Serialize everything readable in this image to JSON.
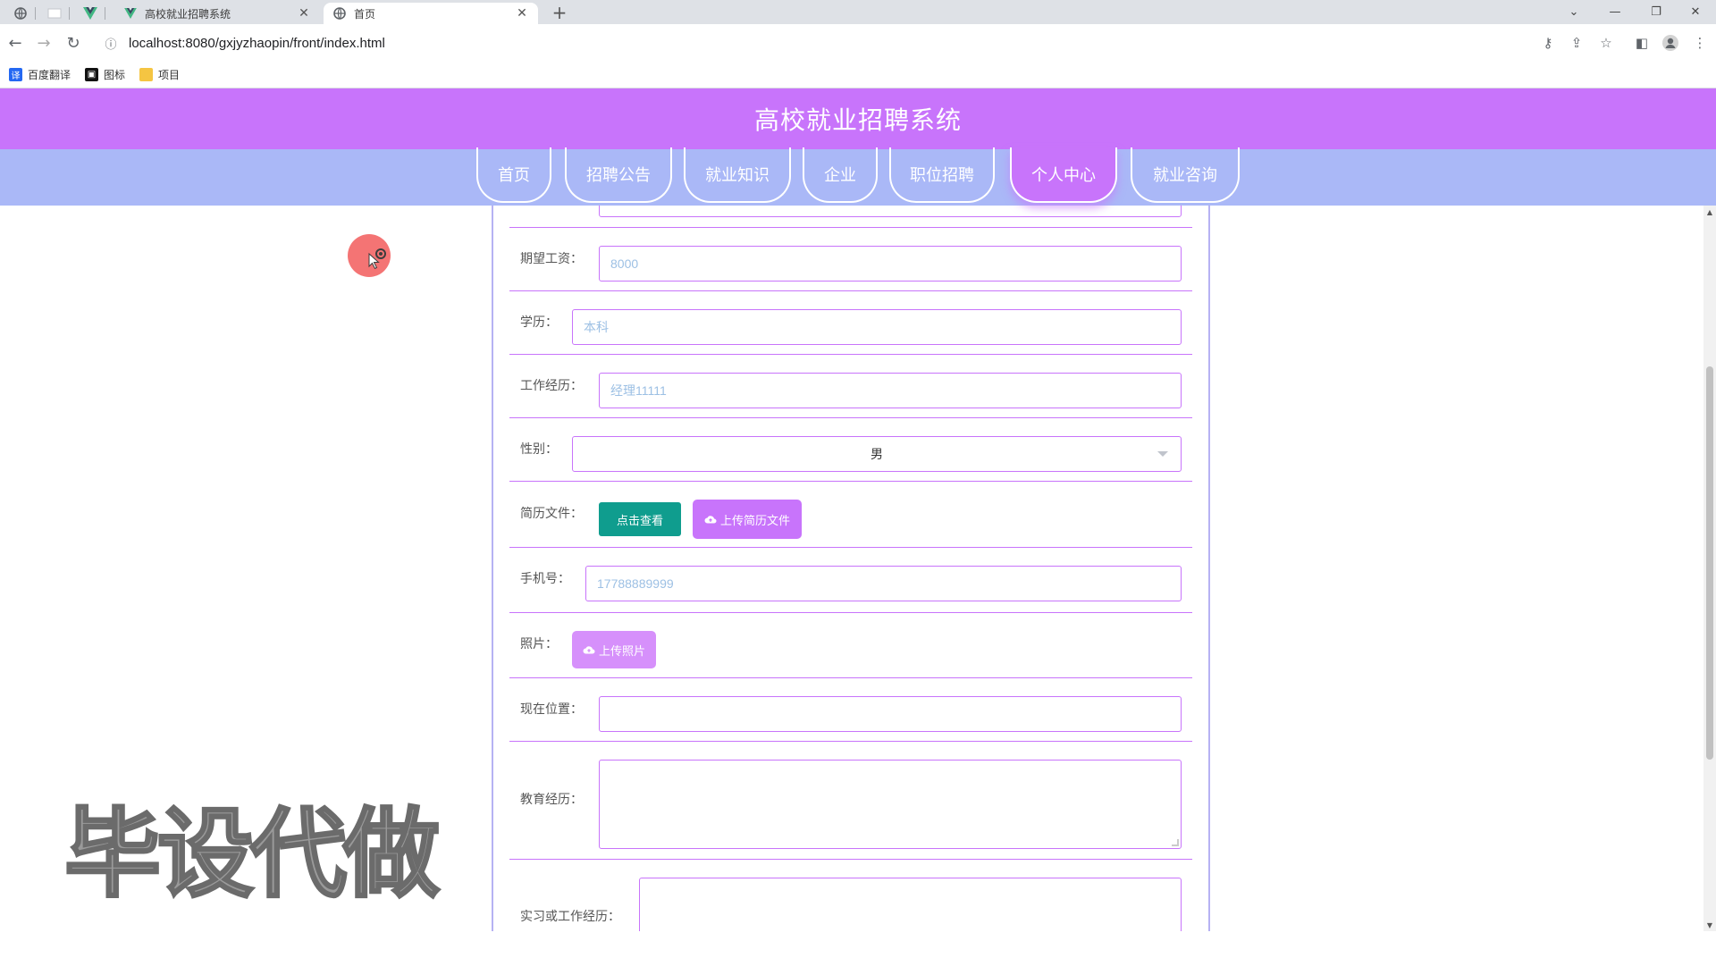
{
  "browser": {
    "tabs": [
      {
        "title": "高校就业招聘系统",
        "active": false
      },
      {
        "title": "首页",
        "active": true
      }
    ],
    "url": "localhost:8080/gxjyzhaopin/front/index.html",
    "bookmarks": [
      {
        "label": "百度翻译",
        "icon": "translate-icon",
        "color": "#2468f2"
      },
      {
        "label": "图标",
        "icon": "image-icon",
        "color": "#111111"
      },
      {
        "label": "项目",
        "icon": "folder-icon",
        "color": "#f5c542"
      }
    ]
  },
  "site": {
    "title": "高校就业招聘系统",
    "nav": [
      {
        "label": "首页",
        "active": false
      },
      {
        "label": "招聘公告",
        "active": false
      },
      {
        "label": "就业知识",
        "active": false
      },
      {
        "label": "企业",
        "active": false
      },
      {
        "label": "职位招聘",
        "active": false
      },
      {
        "label": "个人中心",
        "active": true
      },
      {
        "label": "就业咨询",
        "active": false
      }
    ],
    "header_color": "#c874fb",
    "nav_color": "#aab8f7"
  },
  "form": {
    "expected_salary": {
      "label": "期望工资：",
      "value": "8000"
    },
    "education": {
      "label": "学历：",
      "value": "本科"
    },
    "work_experience": {
      "label": "工作经历：",
      "value": "经理11111"
    },
    "gender": {
      "label": "性别：",
      "value": "男"
    },
    "resume": {
      "label": "简历文件：",
      "view_button": "点击查看",
      "upload_button": "上传简历文件"
    },
    "phone": {
      "label": "手机号：",
      "value": "17788889999"
    },
    "photo": {
      "label": "照片：",
      "upload_button": "上传照片"
    },
    "location": {
      "label": "现在位置：",
      "value": ""
    },
    "education_history": {
      "label": "教育经历：",
      "value": ""
    },
    "internship": {
      "label": "实习或工作经历：",
      "value": ""
    }
  },
  "watermark": "毕设代做"
}
